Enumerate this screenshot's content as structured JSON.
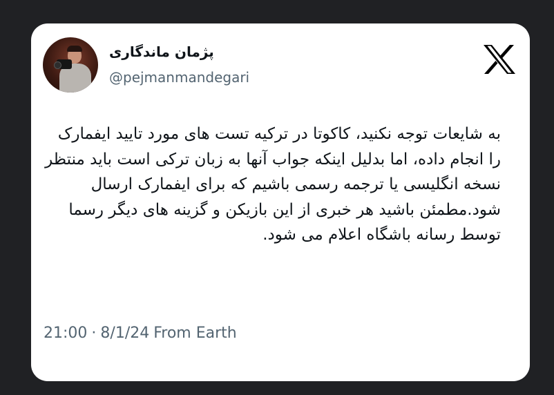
{
  "tweet": {
    "display_name": "پژمان ماندگاری",
    "handle": "@pejmanmandegari",
    "text": "به شایعات توجه نکنید، کاکوتا در ترکیه تست های مورد تایید ایفمارک را انجام داده، اما بدلیل اینکه جواب آنها به زبان ترکی است باید منتظر نسخه انگلیسی یا ترجمه رسمی باشیم که برای ایفمارک ارسال شود.مطمئن باشید هر خبری از این بازیکن و گزینه های دیگر رسما توسط رسانه باشگاه اعلام می شود.",
    "time": "21:00",
    "separator": "·",
    "date": "8/1/24",
    "source": "From Earth"
  },
  "colors": {
    "background": "#202124",
    "card": "#ffffff",
    "text_primary": "#0f1419",
    "text_secondary": "#536471"
  },
  "icons": {
    "logo": "x-logo-icon",
    "avatar": "profile-photo"
  }
}
